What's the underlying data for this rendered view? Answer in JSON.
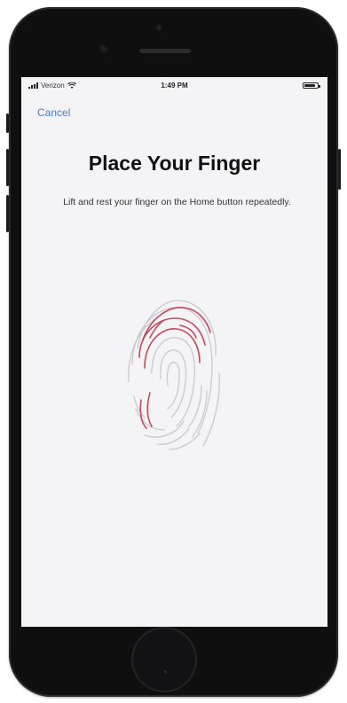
{
  "status_bar": {
    "carrier": "Verizon",
    "time": "1:49 PM"
  },
  "nav": {
    "cancel_label": "Cancel"
  },
  "title": "Place Your Finger",
  "subtitle": "Lift and rest your finger on the Home button repeatedly.",
  "icons": {
    "signal": "cellular-signal-icon",
    "wifi": "wifi-icon",
    "battery": "battery-icon",
    "fingerprint": "fingerprint-icon"
  },
  "colors": {
    "accent": "#4a7bd4",
    "fingerprint_captured": "#c8485c",
    "fingerprint_pending": "#c9c9cf"
  }
}
